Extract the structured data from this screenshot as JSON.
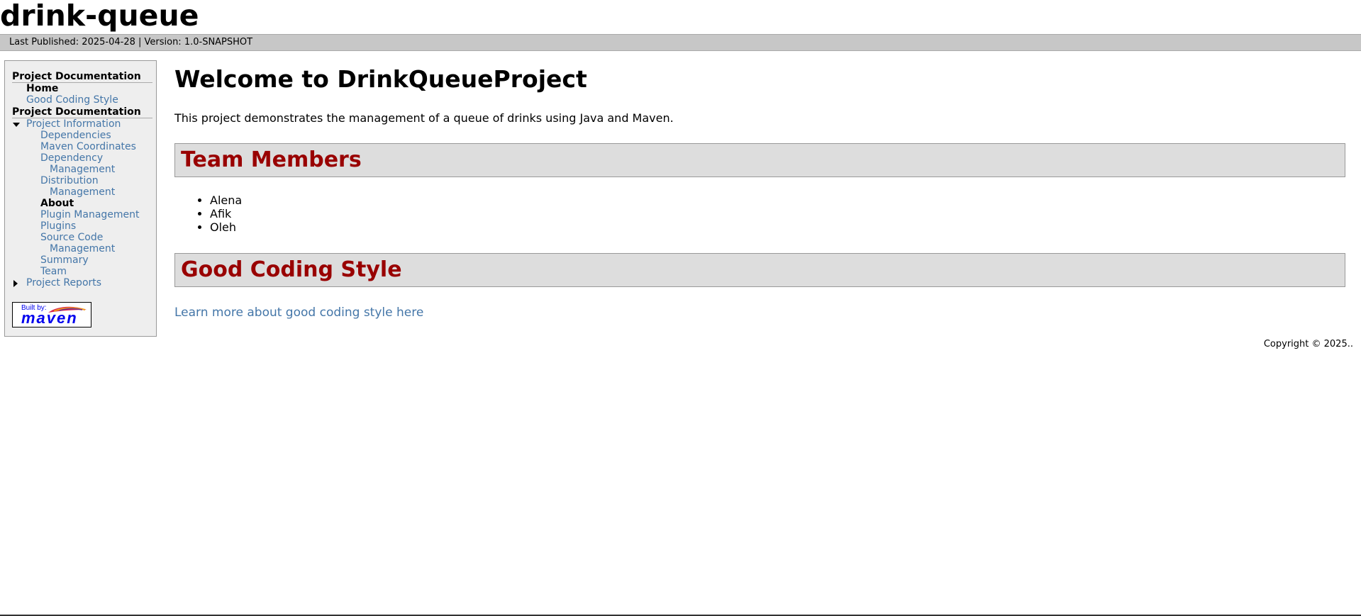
{
  "banner": {
    "title": "drink-queue"
  },
  "breadcrumbs": {
    "text": "Last Published: 2025-04-28 | Version: 1.0-SNAPSHOT"
  },
  "nav": {
    "section1": "Project Documentation",
    "home": "Home",
    "good_coding_style": "Good Coding Style",
    "section2": "Project Documentation",
    "project_information": "Project Information",
    "dependencies": "Dependencies",
    "maven_coordinates": "Maven Coordinates",
    "dependency_management_1": "Dependency",
    "dependency_management_2": "Management",
    "distribution_management_1": "Distribution",
    "distribution_management_2": "Management",
    "about": "About",
    "plugin_management": "Plugin Management",
    "plugins": "Plugins",
    "source_code_management_1": "Source Code",
    "source_code_management_2": "Management",
    "summary": "Summary",
    "team": "Team",
    "project_reports": "Project Reports",
    "built_by": "Built by:",
    "maven_logo": "maven"
  },
  "main": {
    "title": "Welcome to DrinkQueueProject",
    "intro": "This project demonstrates the management of a queue of drinks using Java and Maven.",
    "team_heading": "Team Members",
    "members": [
      "Alena",
      "Afik",
      "Oleh"
    ],
    "coding_heading": "Good Coding Style",
    "coding_link": "Learn more about good coding style here"
  },
  "footer": {
    "copyright": "Copyright © 2025.."
  },
  "colors": {
    "link": "#4476a8",
    "section_heading": "#990000",
    "breadcrumb_bg": "#c7c7c7",
    "nav_bg": "#eeeeee"
  }
}
